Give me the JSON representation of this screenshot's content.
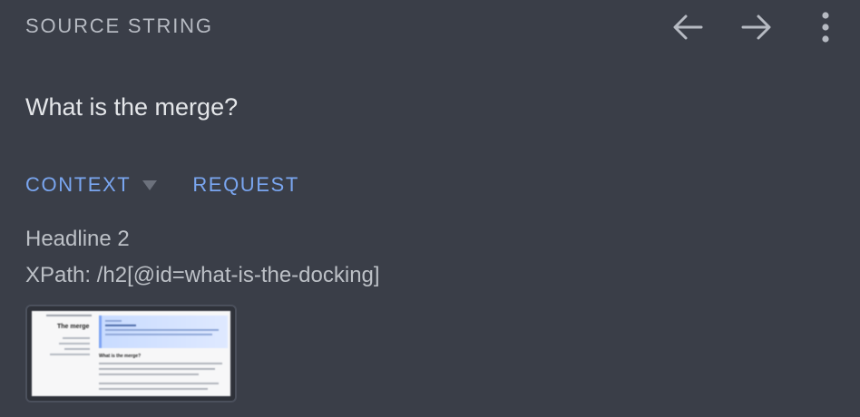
{
  "header": {
    "title": "SOURCE STRING",
    "actions": [
      {
        "name": "back",
        "icon": "arrow-left-icon"
      },
      {
        "name": "forward",
        "icon": "arrow-right-icon"
      },
      {
        "name": "more",
        "icon": "more-vert-icon"
      }
    ]
  },
  "source": {
    "text": "What is the merge?"
  },
  "tabs": [
    {
      "label": "CONTEXT",
      "has_dropdown": true,
      "active": true
    },
    {
      "label": "REQUEST",
      "has_dropdown": false,
      "active": false
    }
  ],
  "context": {
    "type_label": "Headline 2",
    "xpath_label": "XPath: /h2[@id=what-is-the-docking]"
  },
  "thumbnail": {
    "page_title": "The merge",
    "section_heading": "What is the merge?"
  },
  "colors": {
    "background": "#3a3e48",
    "accent": "#7aa6f0",
    "icon": "#b6bac2",
    "muted_text": "#bcc0c6"
  }
}
